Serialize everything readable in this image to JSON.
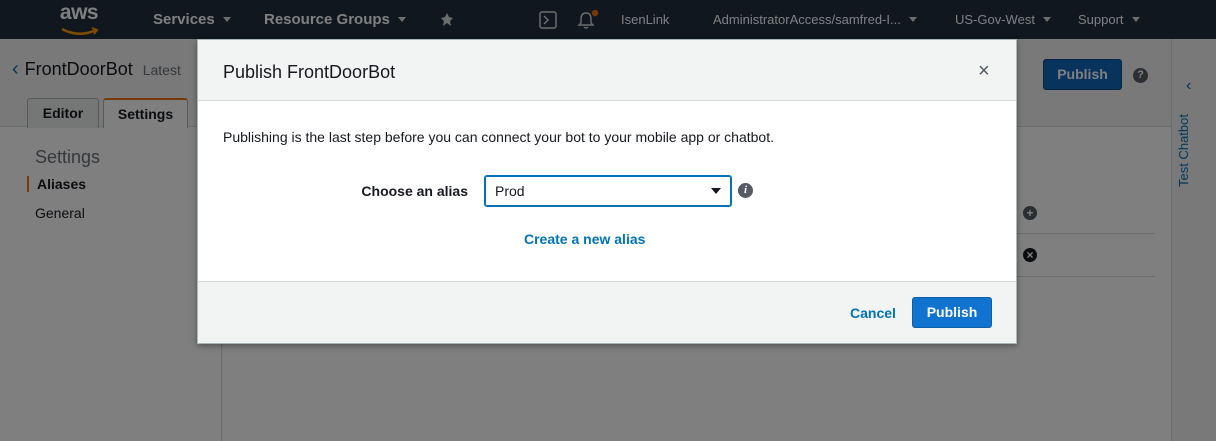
{
  "topnav": {
    "logo_text": "aws",
    "services": "Services",
    "resource_groups": "Resource Groups",
    "user": "IsenLink",
    "account": "AdministratorAccess/samfred-I...",
    "region": "US-Gov-West",
    "support": "Support"
  },
  "page": {
    "bot_name": "FrontDoorBot",
    "version": "Latest",
    "tabs": [
      "Editor",
      "Settings"
    ],
    "publish_label": "Publish",
    "help": "?",
    "sidebar": {
      "heading": "Settings",
      "items": [
        "Aliases",
        "General"
      ]
    },
    "right_panel_label": "Test Chatbot"
  },
  "modal": {
    "title": "Publish FrontDoorBot",
    "close": "×",
    "description": "Publishing is the last step before you can connect your bot to your mobile app or chatbot.",
    "alias_label": "Choose an alias",
    "alias_selected": "Prod",
    "info": "i",
    "create_alias_link": "Create a new alias",
    "cancel_label": "Cancel",
    "publish_label": "Publish"
  },
  "colors": {
    "nav_bg": "#232f3e",
    "primary_button": "#0f73cf",
    "link": "#0073bb",
    "notification_dot": "#ec7211"
  }
}
